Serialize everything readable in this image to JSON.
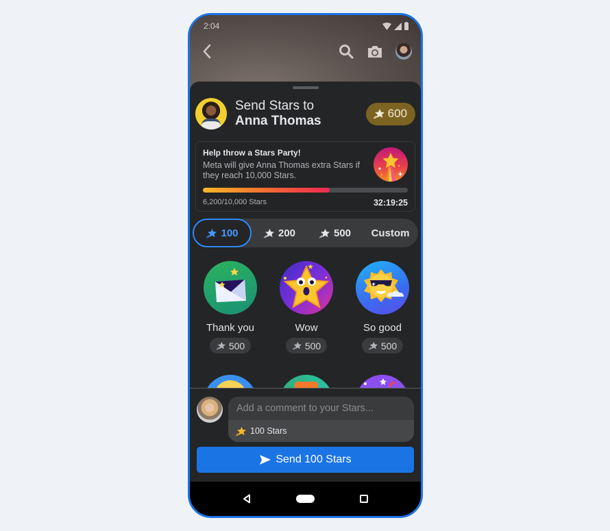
{
  "status_bar": {
    "time": "2:04"
  },
  "app_bar": {
    "back_icon": "chevron-left-icon",
    "search_icon": "search-icon",
    "camera_icon": "camera-icon",
    "profile_icon": "avatar"
  },
  "header": {
    "title_line1": "Send Stars to",
    "recipient": "Anna Thomas",
    "balance": "600"
  },
  "party": {
    "title": "Help throw a Stars Party!",
    "description": "Meta will give Anna Thomas extra Stars if they reach 10,000 Stars.",
    "progress_text": "6,200/10,000 Stars",
    "progress_fraction": 0.62,
    "timer": "32:19:25"
  },
  "amounts": [
    {
      "label": "100",
      "icon": true,
      "selected": true
    },
    {
      "label": "200",
      "icon": true,
      "selected": false
    },
    {
      "label": "500",
      "icon": true,
      "selected": false
    },
    {
      "label": "Custom",
      "icon": false,
      "selected": false
    }
  ],
  "gifts": [
    {
      "label": "Thank you",
      "price": "500",
      "art": "envelope"
    },
    {
      "label": "Wow",
      "price": "500",
      "art": "star-face"
    },
    {
      "label": "So good",
      "price": "500",
      "art": "sun-sunglasses"
    }
  ],
  "composer": {
    "placeholder": "Add a comment to your Stars...",
    "value": "",
    "tag": "100 Stars"
  },
  "send_button": {
    "label": "Send 100 Stars"
  },
  "colors": {
    "accent": "#1b74e4",
    "sheet_bg": "#242526",
    "balance_pill": "#7d6321",
    "selected_amount": "#2d88ff"
  }
}
